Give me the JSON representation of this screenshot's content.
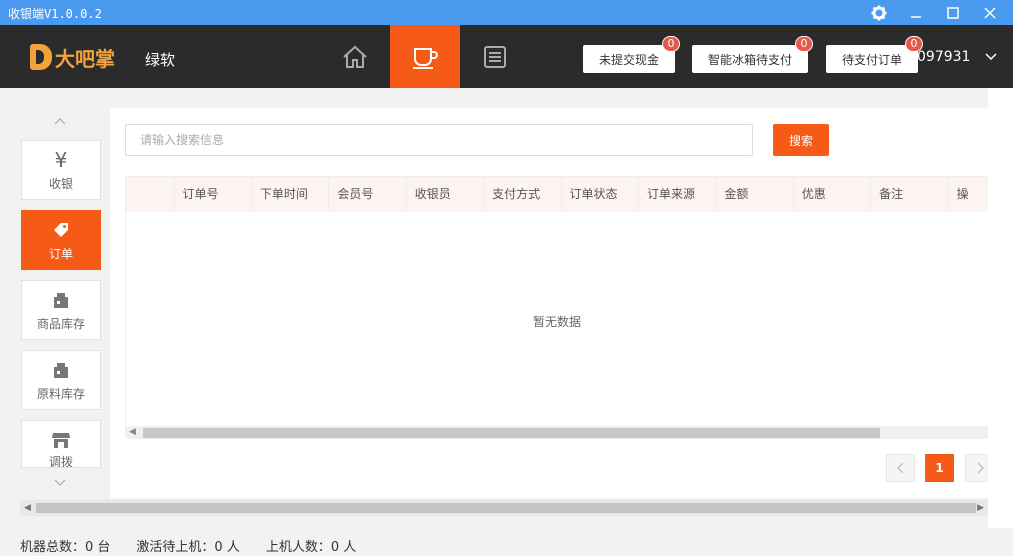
{
  "window": {
    "title": "收银端V1.0.0.2",
    "settings_icon": "gear-icon",
    "minimize_icon": "minimize-icon",
    "maximize_icon": "maximize-icon",
    "close_icon": "close-icon",
    "accent": "#4a9bf0"
  },
  "header": {
    "logo_text": "大吧掌",
    "shop_name": "绿软",
    "nav": [
      {
        "icon": "home-icon"
      },
      {
        "icon": "cup-icon",
        "active": true
      },
      {
        "icon": "list-icon"
      }
    ],
    "buttons": [
      {
        "label": "未提交现金",
        "badge": "0"
      },
      {
        "label": "智能冰箱待支付",
        "badge": "0"
      },
      {
        "label": "待支付订单",
        "badge": "0"
      }
    ],
    "user": "097931",
    "brand_color": "#f55a16"
  },
  "sidebar": {
    "items": [
      {
        "label": "收银",
        "icon": "yen-icon"
      },
      {
        "label": "订单",
        "icon": "tag-icon",
        "active": true
      },
      {
        "label": "商品库存",
        "icon": "box-icon"
      },
      {
        "label": "原料库存",
        "icon": "box-icon"
      },
      {
        "label": "调拨",
        "icon": "store-icon"
      }
    ]
  },
  "main": {
    "search_placeholder": "请输入搜索信息",
    "search_label": "搜索",
    "columns": [
      "订单号",
      "下单时间",
      "会员号",
      "收银员",
      "支付方式",
      "订单状态",
      "订单来源",
      "金额",
      "优惠",
      "备注",
      "操"
    ],
    "empty_text": "暂无数据",
    "pagination": {
      "current": "1",
      "prev_icon": "chevron-left-icon",
      "next_icon": "chevron-right-icon"
    }
  },
  "status": {
    "machines": "机器总数：0 台",
    "pending": "激活待上机：0 人",
    "online": "上机人数：0 人"
  }
}
